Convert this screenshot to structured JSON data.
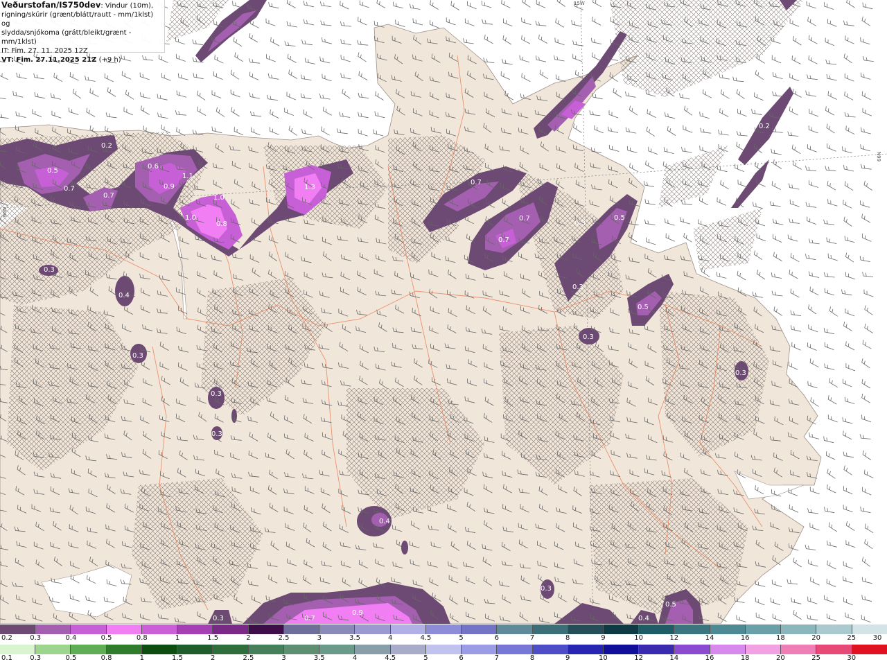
{
  "header": {
    "brand": "Veðurstofan/IS750dev",
    "desc_line1": ": Vindur (10m),",
    "desc_line2": "rigning/skúrir (grænt/blátt/rautt - mm/1klst) og",
    "desc_line3": "slydda/snjókoma (grátt/bleikt/grænt - mm/1klst)",
    "issue_time": "IT: Fim. 27. 11. 2025 12Z",
    "valid_time": "VT: Fim. 27.11.2025 21Z",
    "valid_offset": "(+9 h)"
  },
  "graticule_labels": {
    "top": "15W",
    "right": "66N",
    "left": "66N"
  },
  "colors": {
    "land": "#f1e6da",
    "sea": "#ffffff",
    "roads": "#e8835a",
    "snow_light": "#c760d6",
    "snow_heavy": "#f27ef4",
    "snow_dark": "#6d4a73"
  },
  "precip_labels": [
    {
      "text": "0.2"
    },
    {
      "text": "0.5"
    },
    {
      "text": "0.7"
    },
    {
      "text": "0.7"
    },
    {
      "text": "0.6"
    },
    {
      "text": "0.9"
    },
    {
      "text": "1.1"
    },
    {
      "text": "1.3"
    },
    {
      "text": "1.0"
    },
    {
      "text": "1.0"
    },
    {
      "text": "0.8"
    },
    {
      "text": "0.7"
    },
    {
      "text": "0.7"
    },
    {
      "text": "0.7"
    },
    {
      "text": "0.3"
    },
    {
      "text": "0.5"
    },
    {
      "text": "0.3"
    },
    {
      "text": "0.5"
    },
    {
      "text": "0.3"
    },
    {
      "text": "0.4"
    },
    {
      "text": "0.3"
    },
    {
      "text": "0.3"
    },
    {
      "text": "0.3"
    },
    {
      "text": "0.3"
    },
    {
      "text": "0.4"
    },
    {
      "text": "0.3"
    },
    {
      "text": "0.3"
    },
    {
      "text": "0.9"
    },
    {
      "text": "0.7"
    },
    {
      "text": "0.4"
    },
    {
      "text": "0.5"
    },
    {
      "text": "0.2"
    },
    {
      "text": "0.3"
    }
  ],
  "legend_snow": {
    "labels": [
      "0.2",
      "0.3",
      "0.4",
      "0.5",
      "0.8",
      "1",
      "1.5",
      "2",
      "2.5",
      "3",
      "3.5",
      "4",
      "4.5",
      "5",
      "6",
      "7",
      "8",
      "9",
      "10",
      "12",
      "14",
      "16",
      "18",
      "20",
      "25",
      "30"
    ],
    "colors": [
      "#6d4a73",
      "#a55fb0",
      "#c760d6",
      "#f27ef4",
      "#cc5fd8",
      "#a63fb3",
      "#7a2a86",
      "#3e0e48",
      "#6e6e9a",
      "#8a8ab8",
      "#9a9ad0",
      "#b0b0e6",
      "#8c8cd8",
      "#7474c6",
      "#5e8a9a",
      "#3c6e78",
      "#254e58",
      "#0e3a44",
      "#1e5c66",
      "#3a7580",
      "#4e8a94",
      "#6aa0a8",
      "#8ab6bc",
      "#aacacf",
      "#d4e4e6"
    ]
  },
  "legend_rain": {
    "labels": [
      "0.1",
      "0.3",
      "0.5",
      "0.8",
      "1",
      "1.5",
      "2",
      "2.5",
      "3",
      "3.5",
      "4",
      "4.5",
      "5",
      "6",
      "7",
      "8",
      "9",
      "10",
      "12",
      "14",
      "16",
      "18",
      "20",
      "25",
      "30"
    ],
    "colors": [
      "#d8f5d0",
      "#9ed58e",
      "#5fae55",
      "#2f7d2c",
      "#0d4d10",
      "#1f5e2a",
      "#2f6e3a",
      "#46805a",
      "#5f8f72",
      "#6c9a8a",
      "#889ea8",
      "#a8acc8",
      "#c2c2ee",
      "#9b9be6",
      "#7777d8",
      "#4d4dc8",
      "#2626b2",
      "#0f0f9a",
      "#3a2ab0",
      "#8a4ad2",
      "#d889ee",
      "#f2a2e2",
      "#ef7eb6",
      "#e84a78",
      "#e01222"
    ]
  }
}
